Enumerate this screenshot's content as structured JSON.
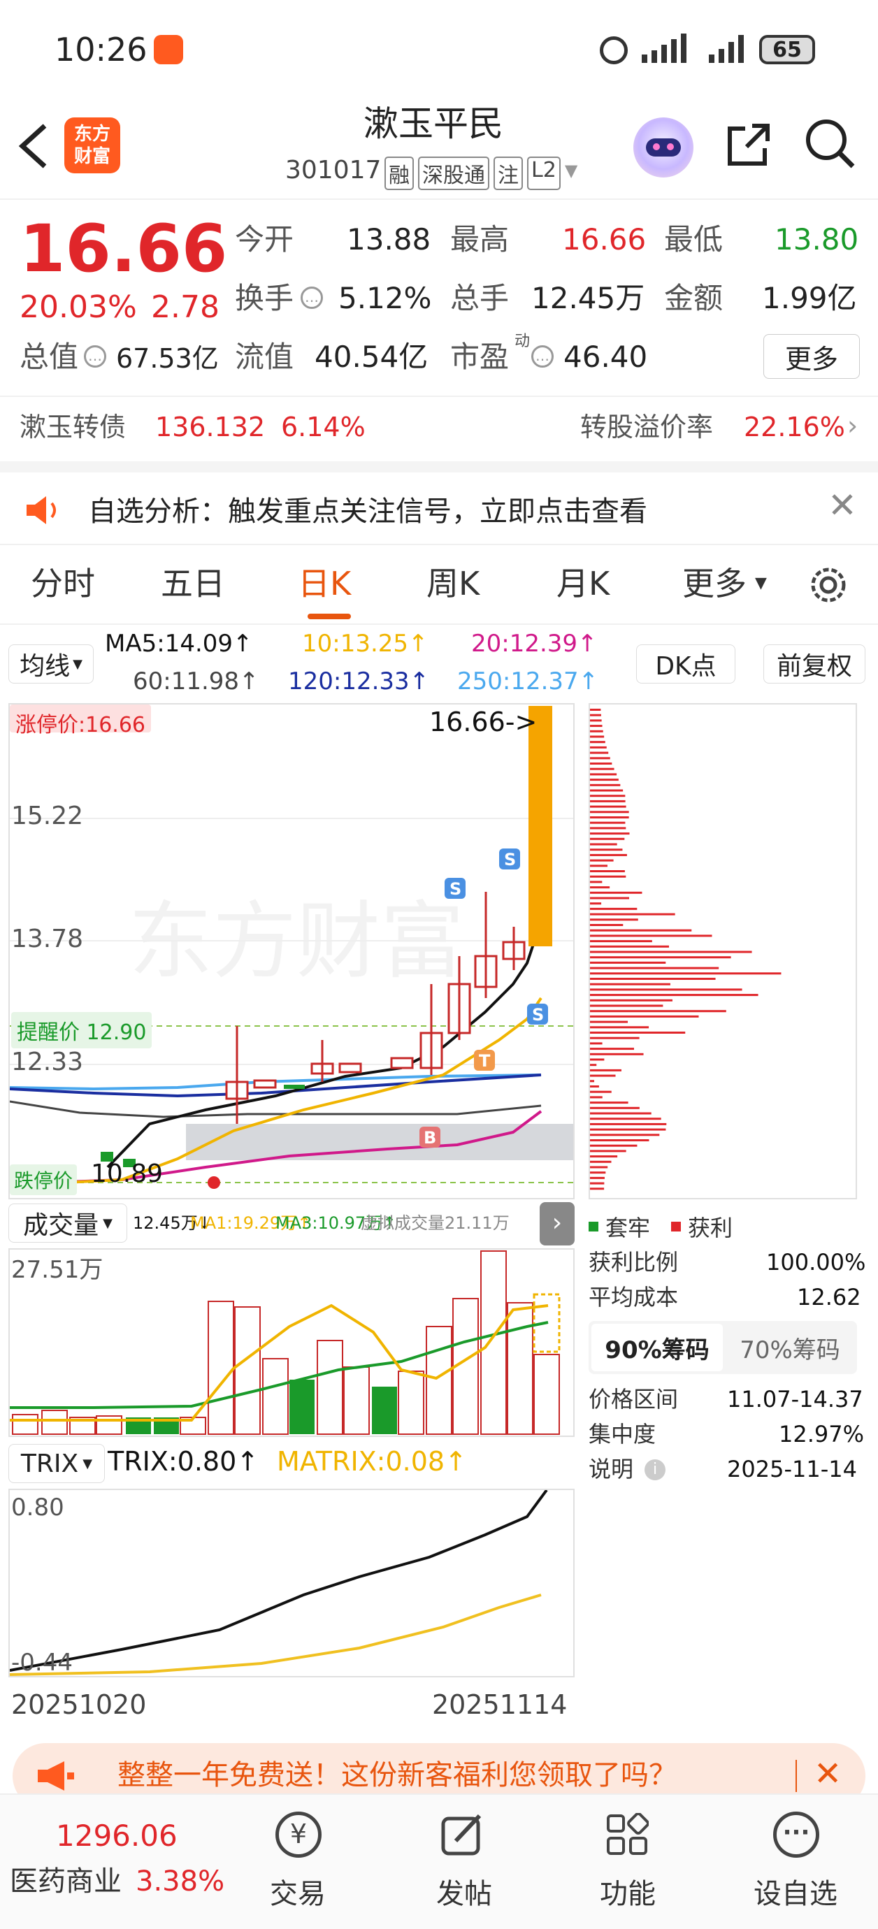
{
  "status_bar": {
    "time": "10:26",
    "battery": "65"
  },
  "header": {
    "title": "漱玉平民",
    "code": "301017",
    "tags": [
      "融",
      "深股通",
      "注",
      "L2"
    ],
    "logo_line1": "东方",
    "logo_line2": "财富"
  },
  "quote": {
    "price": "16.66",
    "change_pct": "20.03%",
    "change_amt": "2.78",
    "open_label": "今开",
    "open": "13.88",
    "high_label": "最高",
    "high": "16.66",
    "low_label": "最低",
    "low": "13.80",
    "turnover_label": "换手",
    "turnover": "5.12%",
    "volume_label": "总手",
    "volume": "12.45万",
    "amount_label": "金额",
    "amount": "1.99亿",
    "mktcap_label": "总值",
    "mktcap": "67.53亿",
    "float_label": "流值",
    "float_cap": "40.54亿",
    "pe_label": "市盈",
    "pe_sup": "动",
    "pe": "46.40",
    "more_button": "更多"
  },
  "bond": {
    "name": "漱玉转债",
    "price": "136.132",
    "pct": "6.14%",
    "premium_label": "转股溢价率",
    "premium": "22.16%"
  },
  "notice": {
    "text": "自选分析：触发重点关注信号，立即点击查看"
  },
  "tabs": [
    "分时",
    "五日",
    "日K",
    "周K",
    "月K",
    "更多"
  ],
  "active_tab": "日K",
  "ma": {
    "selector": "均线",
    "ma5": "MA5:14.09↑",
    "ma10": "10:13.25↑",
    "ma20": "20:12.39↑",
    "ma60": "60:11.98↑",
    "ma120": "120:12.33↑",
    "ma250": "250:12.37↑",
    "dk_button": "DK点",
    "fq_button": "前复权",
    "colors": {
      "ma5": "#111111",
      "ma10": "#f0b400",
      "ma20": "#d0198a",
      "ma60": "#444444",
      "ma120": "#1a2ea0",
      "ma250": "#4aa8ee"
    }
  },
  "kchart": {
    "limit_label": "涨停价:16.66",
    "price_tag": "16.66->",
    "y_labels": [
      "15.22",
      "13.78",
      "12.33"
    ],
    "remind_label": "提醒价 12.90",
    "low_label": "10.89",
    "support_label": "跌停价",
    "low_axis": "10.89",
    "watermark": "东方财富",
    "signals": [
      "S",
      "S",
      "S",
      "T",
      "B"
    ]
  },
  "volume": {
    "selector": "成交量",
    "v": "12.45万↓",
    "ma1": "MA1:19.29万↑",
    "ma3": "MA3:10.97万↑",
    "virtual": "虚拟成交量21.11万",
    "max_label": "27.51万"
  },
  "trix": {
    "selector": "TRIX",
    "trix": "TRIX:0.80↑",
    "matrix": "MATRIX:0.08↑",
    "top": "0.80",
    "bottom": "-0.44"
  },
  "dates": {
    "start": "20251020",
    "end": "20251114"
  },
  "chip": {
    "legend_trapped": "套牢",
    "legend_profit": "获利",
    "profit_ratio_label": "获利比例",
    "profit_ratio": "100.00%",
    "avg_cost_label": "平均成本",
    "avg_cost": "12.62",
    "tab90": "90%筹码",
    "tab70": "70%筹码",
    "range_label": "价格区间",
    "range": "11.07-14.37",
    "concentration_label": "集中度",
    "concentration": "12.97%",
    "desc_label": "说明",
    "date": "2025-11-14"
  },
  "promo": {
    "text": "整整一年免费送！这份新客福利您领取了吗？"
  },
  "bottom_nav": {
    "index_value": "1296.06",
    "index_name": "医药商业",
    "index_pct": "3.38%",
    "items": [
      "交易",
      "发帖",
      "功能",
      "设自选"
    ]
  }
}
